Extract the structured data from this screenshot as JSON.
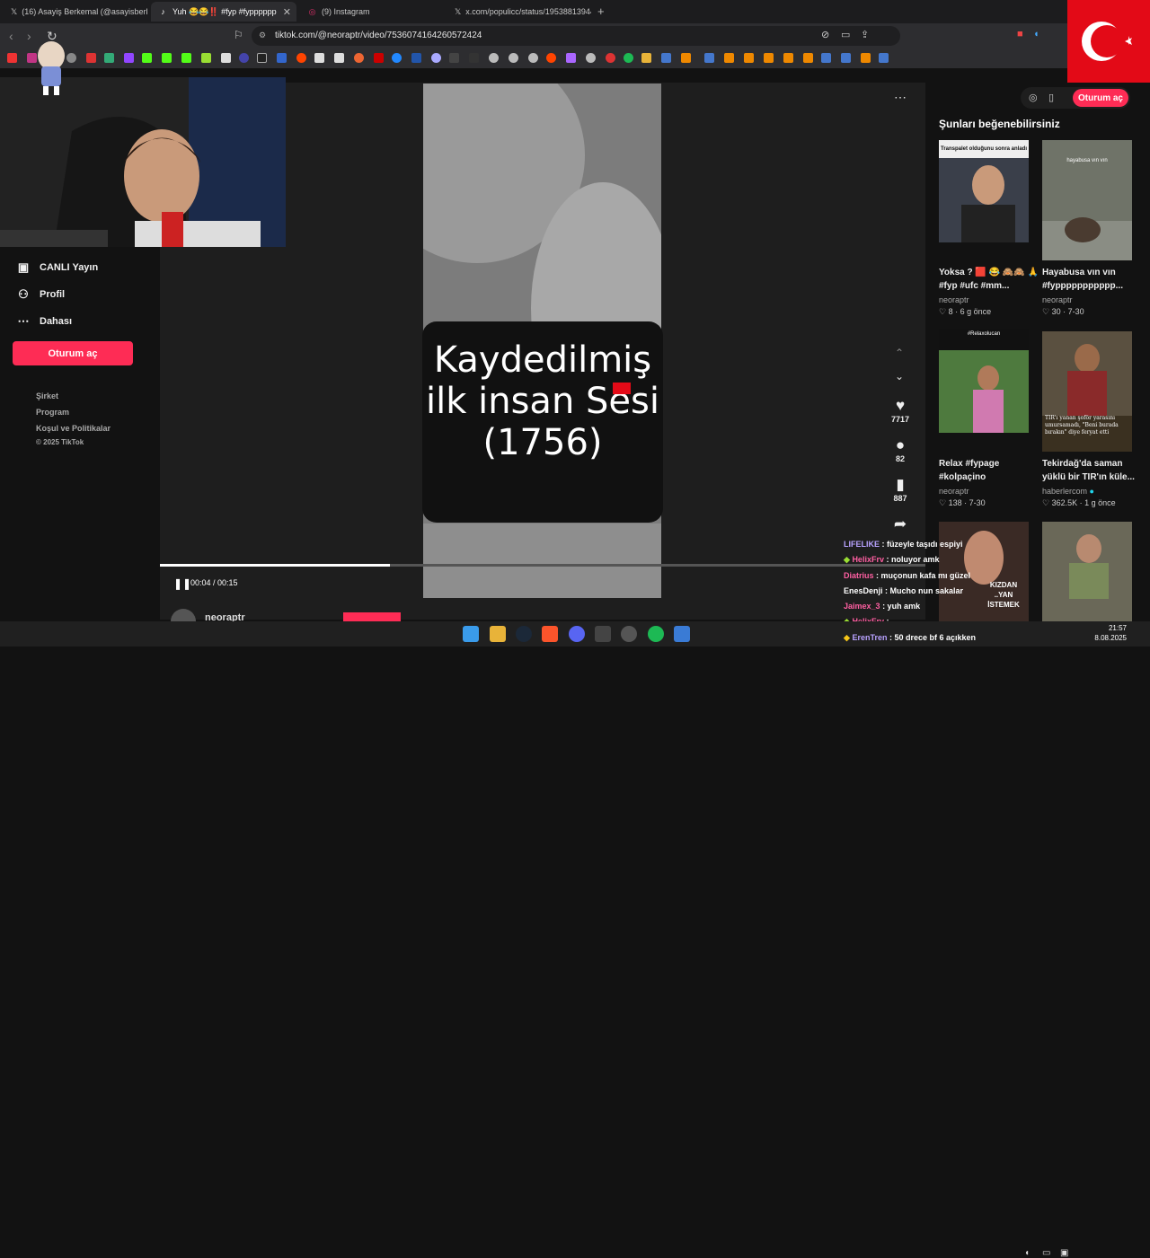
{
  "tabs": [
    {
      "title": "(16) Asayiş Berkemal (@asayisberkem",
      "icon": "x-icon"
    },
    {
      "title": "Yuh 😂😂‼️ #fyp #fypppppp",
      "icon": "tiktok-icon"
    },
    {
      "title": "(9) Instagram",
      "icon": "instagram-icon"
    },
    {
      "title": "x.com/populicc/status/19538813944",
      "icon": "x-icon"
    }
  ],
  "address": {
    "url": "tiktok.com/@neoraptr/video/7536074164260572424"
  },
  "leftnav": {
    "items": [
      {
        "label": "CANLI Yayın",
        "icon": "live-icon"
      },
      {
        "label": "Profil",
        "icon": "user-icon"
      },
      {
        "label": "Dahası",
        "icon": "more-icon"
      }
    ],
    "login": "Oturum aç",
    "footer": [
      "Şirket",
      "Program",
      "Koşul ve Politikalar",
      "© 2025 TikTok"
    ]
  },
  "video": {
    "caption": "Kaydedilmiş ilk insan Sesi (1756)",
    "time": "00:04 / 00:15",
    "progress": 0.3,
    "likes": "7717",
    "comments": "82",
    "saves": "887",
    "author": "neoraptr"
  },
  "rightcol": {
    "login": "Oturum aç",
    "header": "Şunları beğenebilirsiniz",
    "cards": [
      {
        "title": "Yoksa ? 🟥 😂 🙈🙈 🙏 #fyp #ufc #mm...",
        "author": "neoraptr",
        "likes": "8",
        "age": "6 g önce",
        "overlay": "Transpalet olduğunu sonra anladı"
      },
      {
        "title": "Hayabusa vın vın #fyppppppppppp...",
        "author": "neoraptr",
        "likes": "30",
        "age": "7-30",
        "overlay": "hayabusa vın vın"
      },
      {
        "title": "Relax #fypage #kolpaçino",
        "author": "neoraptr",
        "likes": "138",
        "age": "7-30",
        "overlay": "#Relaxolucan"
      },
      {
        "title": "Tekirdağ'da saman yüklü bir TIR'ın küle...",
        "author": "haberlercom",
        "likes": "362.5K",
        "age": "1 g önce",
        "overlay": "TIR'ı yanan şoför yarasını umursamadı, \"Beni burada bırakın\" diye feryat etti"
      },
      {
        "title": "",
        "author": "",
        "likes": "",
        "age": "",
        "overlay": "KIZDAN ..YAN İSTEMEK"
      }
    ]
  },
  "chat": [
    {
      "user": "LIFELIKE",
      "msg": ": füzeyle taşıdı espiyi",
      "color": "#b8a2ff"
    },
    {
      "user": "HelixFrv",
      "msg": ": noluyor amk",
      "color": "#ff5fa2"
    },
    {
      "user": "Diatrius",
      "msg": ": muçonun kafa mı güzel",
      "color": "#ff5fa2"
    },
    {
      "user": "EnesDenji",
      "msg": ": Mucho nun sakalar",
      "color": "#ffffff"
    },
    {
      "user": "Jaimex_3",
      "msg": ": yuh amk",
      "color": "#ff5fa2"
    },
    {
      "user": "HelixFrv",
      "msg": ":",
      "color": "#ff5fa2"
    },
    {
      "user": "ErenTren",
      "msg": ": 50 drece bf 6 açıkken",
      "color": "#b8a2ff"
    }
  ],
  "clock": {
    "time": "21:57",
    "date": "8.08.2025"
  },
  "colors": {
    "accent": "#fe2c55",
    "flag": "#e30a17"
  }
}
